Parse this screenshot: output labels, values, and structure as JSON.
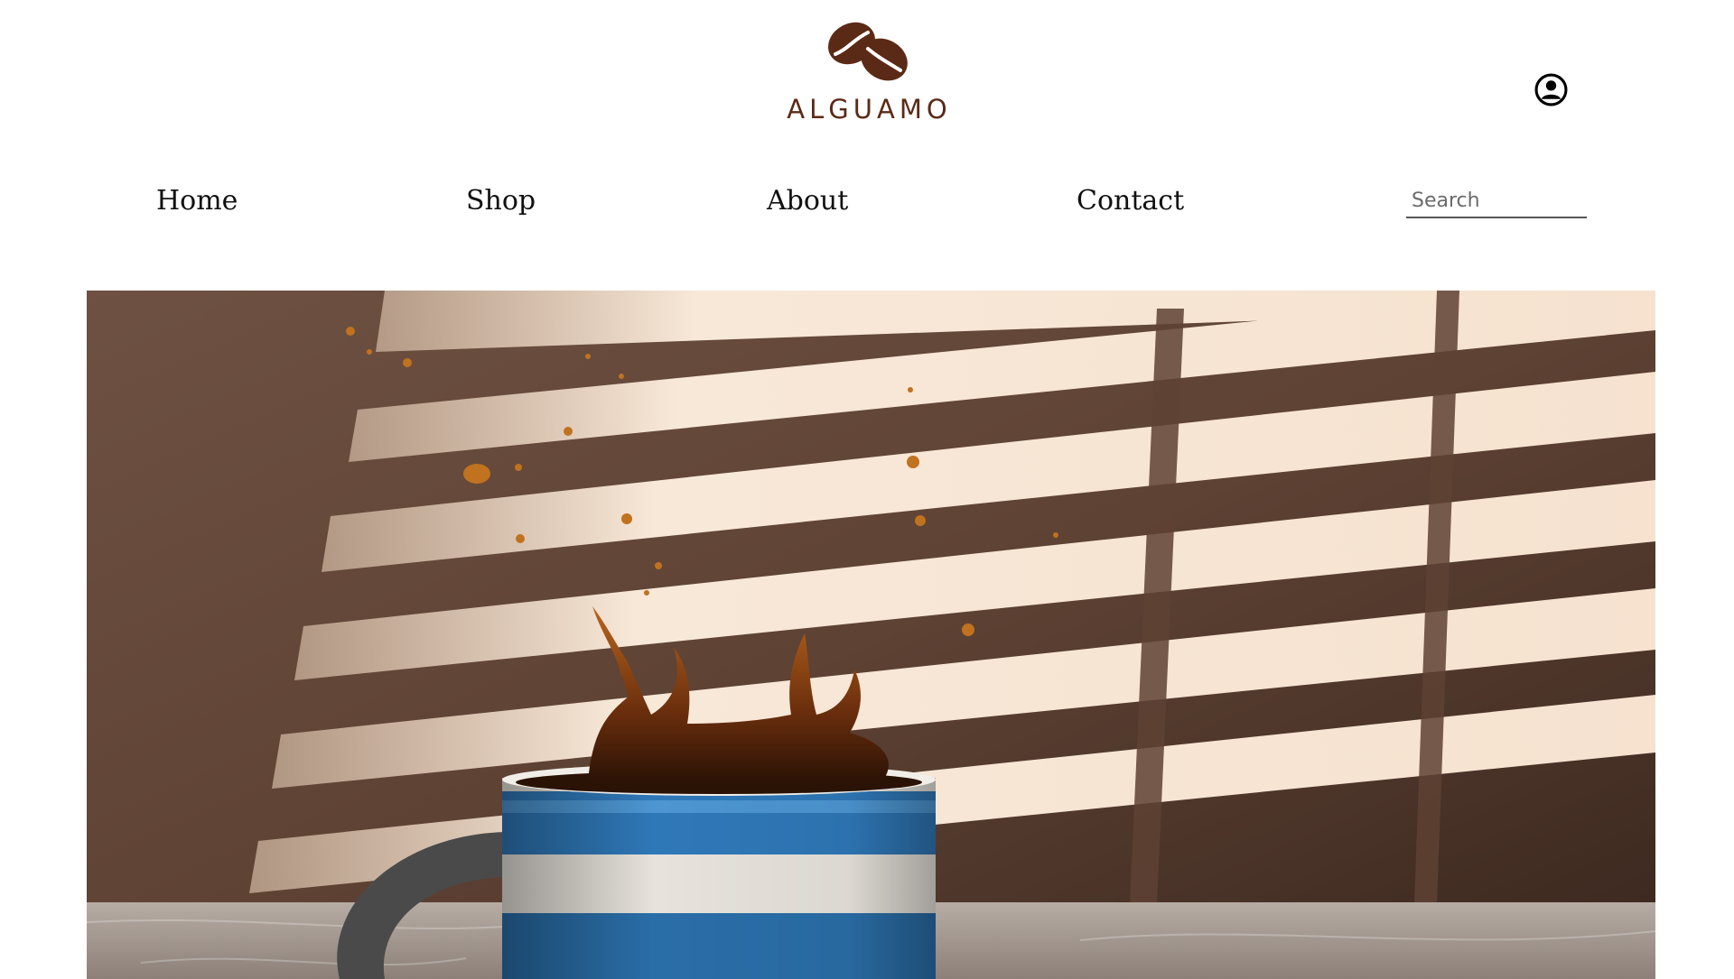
{
  "header": {
    "brand_name": "ALGUAMO",
    "logo_icon": "coffee-beans-icon",
    "account_icon": "user-circle-icon"
  },
  "nav": {
    "items": [
      {
        "label": "Home"
      },
      {
        "label": "Shop"
      },
      {
        "label": "About"
      },
      {
        "label": "Contact"
      }
    ],
    "search": {
      "placeholder": "Search",
      "value": ""
    }
  },
  "hero": {
    "image": "coffee splashing out of a blue and white striped mug with window blind shadows"
  },
  "colors": {
    "brand": "#5b2a16",
    "text": "#111111",
    "background": "#ffffff"
  }
}
